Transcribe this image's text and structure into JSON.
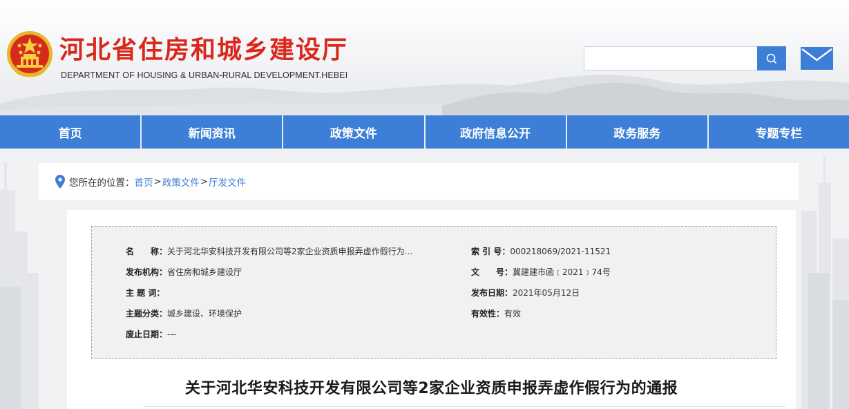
{
  "header": {
    "title": "河北省住房和城乡建设厅",
    "subtitle": "DEPARTMENT OF HOUSING & URBAN-RURAL DEVELOPMENT.HEBEI",
    "search_placeholder": "",
    "colors": {
      "title": "#d9271c",
      "accent": "#3d7fd6"
    }
  },
  "nav": {
    "items": [
      {
        "label": "首页"
      },
      {
        "label": "新闻资讯"
      },
      {
        "label": "政策文件"
      },
      {
        "label": "政府信息公开"
      },
      {
        "label": "政务服务"
      },
      {
        "label": "专题专栏"
      }
    ]
  },
  "breadcrumb": {
    "prefix": "您所在的位置：",
    "items": [
      "首页",
      "政策文件",
      "厅发文件"
    ],
    "separator": ">"
  },
  "meta": {
    "name_label": "名　　称：",
    "name_value": "关于河北华安科技开发有限公司等2家企业资质申报弄虚作假行为...",
    "index_label": "索 引 号：",
    "index_value": "000218069/2021-11521",
    "org_label": "发布机构：",
    "org_value": "省住房和城乡建设厅",
    "docno_label": "文　　号：",
    "docno_value": "冀建建市函﹝2021﹞74号",
    "keywords_label": "主 题 词：",
    "keywords_value": "",
    "date_label": "发布日期：",
    "date_value": "2021年05月12日",
    "category_label": "主题分类：",
    "category_value": "城乡建设、环境保护",
    "validity_label": "有效性：",
    "validity_value": "有效",
    "expire_label": "废止日期：",
    "expire_value": "---"
  },
  "document": {
    "title": "关于河北华安科技开发有限公司等2家企业资质申报弄虚作假行为的通报"
  }
}
